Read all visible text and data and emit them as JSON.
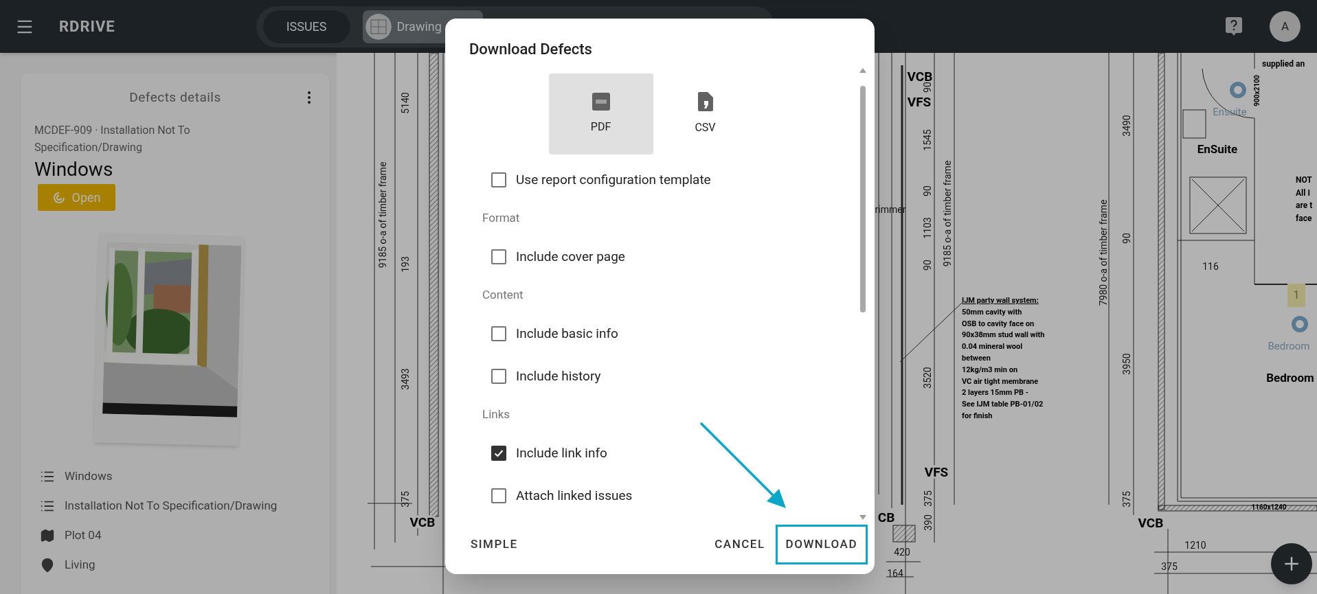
{
  "topbar": {
    "logo": "RDRIVE",
    "tabs": [
      {
        "label": "ISSUES",
        "selected": false,
        "kind": "text"
      },
      {
        "label": "Drawing",
        "selected": true,
        "kind": "thumb"
      }
    ],
    "avatar": "A"
  },
  "panel": {
    "title": "Defects details",
    "reference": "MCDEF-909 · Installation Not To Specification/Drawing",
    "name": "Windows",
    "status": "Open",
    "details": [
      {
        "kind": "list",
        "text": "Windows"
      },
      {
        "kind": "list",
        "text": "Installation Not To Specification/Drawing"
      },
      {
        "kind": "map",
        "text": "Plot 04"
      },
      {
        "kind": "pin",
        "text": "Living"
      }
    ]
  },
  "plan": {
    "labels": [
      {
        "kind": "dim-v",
        "text": "5140"
      },
      {
        "kind": "dim-v",
        "text": "9185 o-a of timber frame"
      },
      {
        "kind": "dim-v",
        "text": "193"
      },
      {
        "kind": "dim-v",
        "text": "3493"
      },
      {
        "kind": "dim-v",
        "text": "375"
      },
      {
        "kind": "tag",
        "text": "VCB"
      },
      {
        "kind": "tag",
        "text": "VCB"
      },
      {
        "kind": "dim-v",
        "text": "90"
      },
      {
        "kind": "tag",
        "text": "VFS"
      },
      {
        "kind": "dim-v",
        "text": "1545"
      },
      {
        "kind": "dim-v",
        "text": "90"
      },
      {
        "kind": "dim-v",
        "text": "1103"
      },
      {
        "kind": "dim-v",
        "text": "90"
      },
      {
        "kind": "dim-v",
        "text": "9185 o-a of timber frame"
      },
      {
        "kind": "dim-h",
        "text": "rimmer"
      },
      {
        "kind": "dim-v",
        "text": "3520"
      },
      {
        "kind": "tag",
        "text": "VFS"
      },
      {
        "kind": "dim-v",
        "text": "375"
      },
      {
        "kind": "dim-v",
        "text": "390"
      },
      {
        "kind": "tag",
        "text": "CB"
      },
      {
        "kind": "dim-h",
        "text": "420"
      },
      {
        "kind": "dim-h",
        "text": "164"
      },
      {
        "kind": "dim-v",
        "text": "3490"
      },
      {
        "kind": "dim-v",
        "text": "7980 o-a of timber frame"
      },
      {
        "kind": "dim-v",
        "text": "90"
      },
      {
        "kind": "dim-v",
        "text": "3950"
      },
      {
        "kind": "dim-v",
        "text": "375"
      },
      {
        "kind": "tag",
        "text": "VCB"
      },
      {
        "kind": "dim-h",
        "text": "1210"
      },
      {
        "kind": "dim-h",
        "text": "375"
      },
      {
        "kind": "tiny",
        "text": "1160x1240"
      },
      {
        "kind": "room",
        "text": "EnSuite"
      },
      {
        "kind": "mark-v",
        "text": "900x2100"
      },
      {
        "kind": "dim-h",
        "text": "116"
      },
      {
        "kind": "note-word",
        "text": "supplied an"
      },
      {
        "kind": "note-word",
        "text": "NOT"
      },
      {
        "kind": "note-word",
        "text": "All I"
      },
      {
        "kind": "note-word",
        "text": "are t"
      },
      {
        "kind": "note-word",
        "text": "face"
      },
      {
        "kind": "room",
        "text": "Bedroom"
      }
    ],
    "note": [
      "IJM party wall system:",
      "50mm cavity with",
      "OSB to cavity face on",
      "90x38mm stud wall with",
      "0.04 mineral wool",
      "between",
      "12kg/m3 min on",
      "VC air tight membrane",
      "2 layers 15mm PB -",
      "See IJM table PB-01/02",
      "for finish"
    ],
    "pins": [
      {
        "label": "Ensuite"
      },
      {
        "label": "Bedroom"
      }
    ],
    "markers": [
      {
        "text": "1"
      }
    ]
  },
  "dialog": {
    "title": "Download Defects",
    "formats": [
      {
        "kind": "pdf",
        "label": "PDF",
        "selected": true
      },
      {
        "kind": "csv",
        "label": "CSV",
        "selected": false
      }
    ],
    "options": [
      {
        "kind": "checkbox",
        "label": "Use report configuration template",
        "checked": false
      },
      {
        "kind": "heading",
        "label": "Format"
      },
      {
        "kind": "checkbox",
        "label": "Include cover page",
        "checked": false
      },
      {
        "kind": "heading",
        "label": "Content"
      },
      {
        "kind": "checkbox",
        "label": "Include basic info",
        "checked": false
      },
      {
        "kind": "checkbox",
        "label": "Include history",
        "checked": false
      },
      {
        "kind": "heading",
        "label": "Links"
      },
      {
        "kind": "checkbox",
        "label": "Include link info",
        "checked": true
      },
      {
        "kind": "checkbox",
        "label": "Attach linked issues",
        "checked": false
      }
    ],
    "actions": [
      {
        "label": "SIMPLE",
        "highlighted": false
      },
      {
        "label": "CANCEL",
        "highlighted": false
      },
      {
        "label": "DOWNLOAD",
        "highlighted": true
      }
    ]
  }
}
